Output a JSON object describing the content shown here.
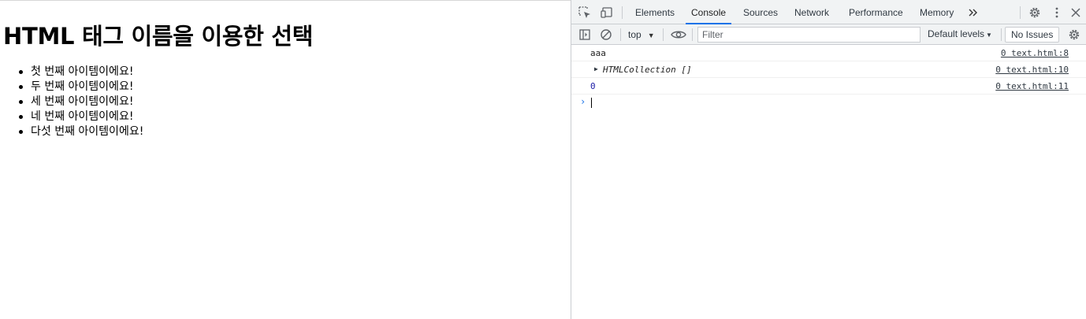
{
  "page": {
    "heading": "HTML 태그 이름을 이용한 선택",
    "items": [
      "첫 번째 아이템이에요!",
      "두 번째 아이템이에요!",
      "세 번째 아이템이에요!",
      "네 번째 아이템이에요!",
      "다섯 번째 아이템이에요!"
    ]
  },
  "devtools": {
    "tabs": [
      "Elements",
      "Console",
      "Sources",
      "Network",
      "Performance",
      "Memory"
    ],
    "active_tab": "Console",
    "toolbar": {
      "context": "top",
      "filter_placeholder": "Filter",
      "levels_label": "Default levels",
      "issues_label": "No Issues"
    },
    "console": {
      "messages": [
        {
          "text": "aaa",
          "source": "0 text.html:8"
        },
        {
          "text": "HTMLCollection []",
          "source": "0 text.html:10"
        },
        {
          "text": "0",
          "source": "0 text.html:11"
        }
      ],
      "prompt": "›"
    },
    "icons": {
      "accent": "#1a73e8",
      "names": [
        "inspect-icon",
        "device-toggle-icon",
        "more-tabs-icon",
        "settings-icon",
        "kebab-menu-icon",
        "close-icon",
        "sidebar-toggle-icon",
        "clear-console-icon",
        "live-expression-eye-icon",
        "console-settings-icon"
      ]
    }
  }
}
